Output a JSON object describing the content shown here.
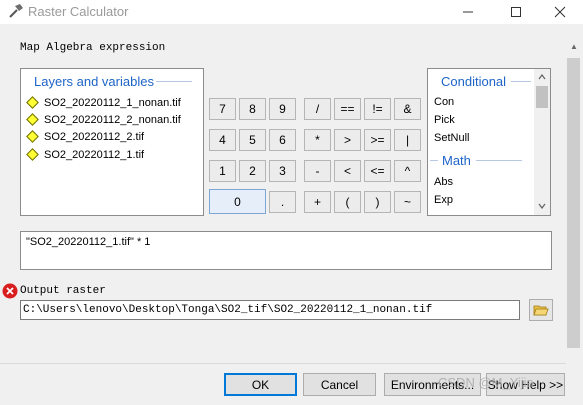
{
  "window": {
    "title": "Raster Calculator",
    "minimize_icon": "minimize-icon",
    "maximize_icon": "maximize-icon",
    "close_icon": "close-icon"
  },
  "expression_label": "Map Algebra expression",
  "layers": {
    "header": "Layers and variables",
    "items": [
      "SO2_20220112_1_nonan.tif",
      "SO2_20220112_2_nonan.tif",
      "SO2_20220112_2.tif",
      "SO2_20220112_1.tif"
    ]
  },
  "keypad": {
    "row1": [
      "7",
      "8",
      "9",
      "/",
      "==",
      "!=",
      "&"
    ],
    "row2": [
      "4",
      "5",
      "6",
      "*",
      ">",
      ">=",
      "|"
    ],
    "row3": [
      "1",
      "2",
      "3",
      "-",
      "<",
      "<=",
      "^"
    ],
    "row4": [
      "0",
      ".",
      "+",
      "(",
      ")",
      "~"
    ]
  },
  "functions": {
    "conditional_header": "Conditional",
    "conditional_items": [
      "Con",
      "Pick",
      "SetNull"
    ],
    "math_header": "Math",
    "math_items": [
      "Abs",
      "Exp"
    ]
  },
  "expression_value": "\"SO2_20220112_1.tif\" * 1",
  "output": {
    "label": "Output raster",
    "error_icon": "error-icon",
    "path": "C:\\Users\\lenovo\\Desktop\\Tonga\\SO2_tif\\SO2_20220112_1_nonan.tif",
    "browse_icon": "folder-open-icon"
  },
  "buttons": {
    "ok": "OK",
    "cancel": "Cancel",
    "environments": "Environments...",
    "show_help": "Show Help >>"
  },
  "watermark": "CSDN @M_Yijia"
}
